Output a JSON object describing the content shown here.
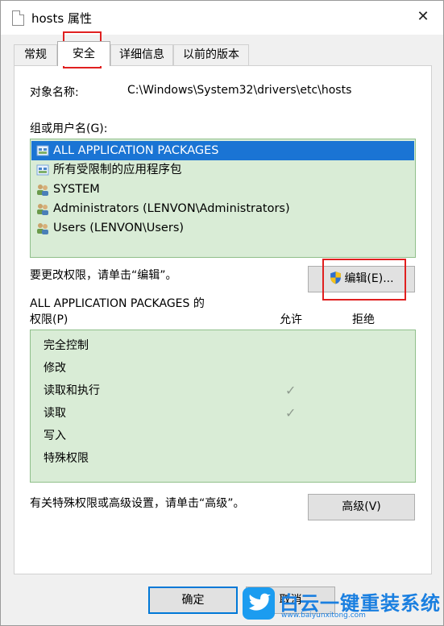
{
  "window": {
    "title": "hosts 属性",
    "close_icon": "close-icon"
  },
  "tabs": [
    {
      "label": "常规"
    },
    {
      "label": "安全"
    },
    {
      "label": "详细信息"
    },
    {
      "label": "以前的版本"
    }
  ],
  "object": {
    "label": "对象名称:",
    "value": "C:\\Windows\\System32\\drivers\\etc\\hosts"
  },
  "groups": {
    "label": "组或用户名(G):",
    "items": [
      {
        "label": "ALL APPLICATION PACKAGES",
        "icon": "package-icon",
        "selected": true
      },
      {
        "label": "所有受限制的应用程序包",
        "icon": "package-icon",
        "selected": false
      },
      {
        "label": "SYSTEM",
        "icon": "users-icon",
        "selected": false
      },
      {
        "label": "Administrators (LENVON\\Administrators)",
        "icon": "users-icon",
        "selected": false
      },
      {
        "label": "Users (LENVON\\Users)",
        "icon": "users-icon",
        "selected": false
      }
    ]
  },
  "change_hint": "要更改权限，请单击“编辑”。",
  "edit_button": {
    "label": "编辑(E)...",
    "icon": "shield-icon"
  },
  "permissions": {
    "header_line1": "ALL APPLICATION PACKAGES 的",
    "header_line2": "权限(P)",
    "allow_label": "允许",
    "deny_label": "拒绝",
    "rows": [
      {
        "name": "完全控制",
        "allow": false,
        "deny": false
      },
      {
        "name": "修改",
        "allow": false,
        "deny": false
      },
      {
        "name": "读取和执行",
        "allow": true,
        "deny": false
      },
      {
        "name": "读取",
        "allow": true,
        "deny": false
      },
      {
        "name": "写入",
        "allow": false,
        "deny": false
      },
      {
        "name": "特殊权限",
        "allow": false,
        "deny": false
      }
    ],
    "check_glyph": "✓"
  },
  "advanced_hint": "有关特殊权限或高级设置，请单击“高级”。",
  "advanced_button": {
    "label": "高级(V)"
  },
  "footer": {
    "ok_label": "确定",
    "cancel_label": "取消"
  },
  "watermark": {
    "text": "白云一键重装系统",
    "url": "www.baiyunxitong.com"
  },
  "colors": {
    "highlight": "#1a74d4",
    "list_bg": "#d9ecd6",
    "annotation_red": "#e02020",
    "watermark_blue": "#1a7fe0"
  }
}
